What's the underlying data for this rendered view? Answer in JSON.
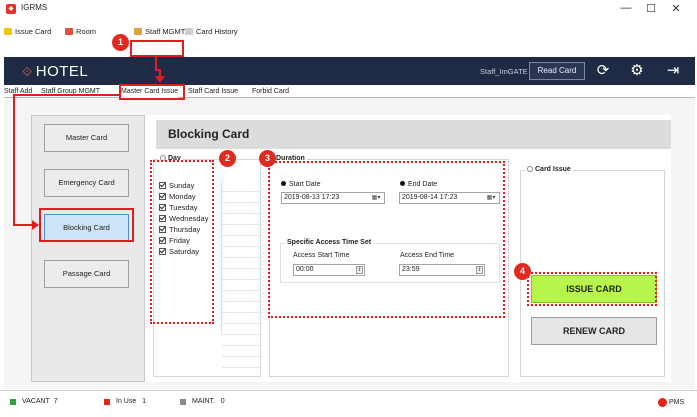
{
  "window": {
    "title": "IGRMS",
    "minimize": "—",
    "maximize": "☐",
    "close": "✕"
  },
  "menu": {
    "items": [
      {
        "label": "Issue Card",
        "color": "#f0c419"
      },
      {
        "label": "Room",
        "color": "#e0523a"
      },
      {
        "label": "Staff MGMT",
        "color": "#d9a440"
      },
      {
        "label": "Card History",
        "color": "#cfcfcf"
      }
    ]
  },
  "header": {
    "logo": "HOTEL",
    "user": "Staff_ImGATE",
    "read_card": "Read Card",
    "icons": [
      "refresh-icon",
      "gear-icon",
      "logout-icon"
    ]
  },
  "tabs": [
    {
      "label": "Staff Add"
    },
    {
      "label": "Staff Group MGMT"
    },
    {
      "label": "Master Card Issue"
    },
    {
      "label": "Staff Card Issue"
    },
    {
      "label": "Forbid Card"
    }
  ],
  "sidebar": {
    "buttons": [
      {
        "label": "Master Card"
      },
      {
        "label": "Emergency Card"
      },
      {
        "label": "Blocking Card"
      },
      {
        "label": "Passage Card"
      }
    ]
  },
  "main": {
    "title": "Blocking Card",
    "day_group": {
      "title": "Day",
      "days": [
        "Sunday",
        "Monday",
        "Tuesday",
        "Wednesday",
        "Thursday",
        "Friday",
        "Saturday"
      ]
    },
    "duration": {
      "title": "Duration",
      "start_label": "Start Date",
      "start_value": "2019-08-13 17:23",
      "end_label": "End Date",
      "end_value": "2019-08-14 17:23",
      "specific_title": "Specific Access Time Set",
      "access_start_label": "Access Start Time",
      "access_start_value": "00:00",
      "access_end_label": "Access End Time",
      "access_end_value": "23:59"
    },
    "card_issue": {
      "title": "Card Issue",
      "issue": "ISSUE CARD",
      "renew": "RENEW CARD"
    }
  },
  "status": {
    "vacant": "VACANT",
    "vacant_count": "7",
    "in_use": "In Use",
    "in_use_count": "1",
    "maint": "MAINT.",
    "maint_count": "0",
    "pms": "PMS"
  },
  "annotations": [
    "1",
    "2",
    "3",
    "4"
  ],
  "colors": {
    "header_bg": "#1f2a44",
    "issue_green": "#b7f54a",
    "annotation_red": "#e01e1e"
  }
}
